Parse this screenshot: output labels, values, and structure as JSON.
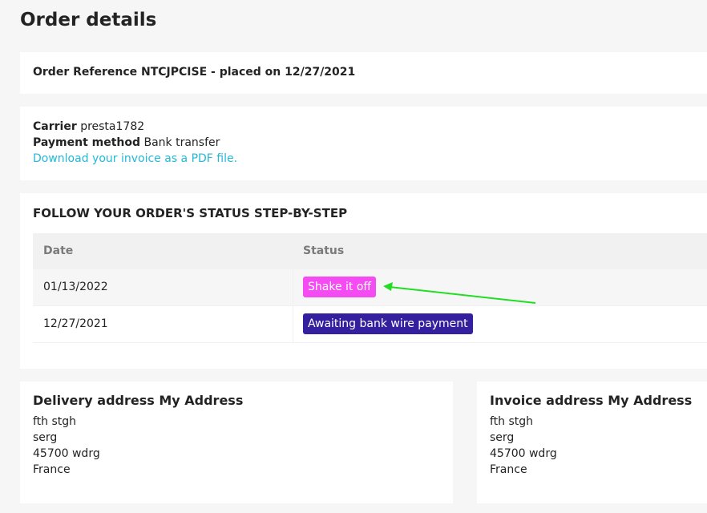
{
  "page": {
    "title": "Order details"
  },
  "reference": {
    "text": "Order Reference NTCJPCISE - placed on 12/27/2021"
  },
  "info": {
    "carrier_label": "Carrier",
    "carrier_value": "presta1782",
    "payment_label": "Payment method",
    "payment_value": "Bank transfer",
    "invoice_link": "Download your invoice as a PDF file."
  },
  "status_section": {
    "heading": "FOLLOW YOUR ORDER'S STATUS STEP-BY-STEP",
    "columns": [
      "Date",
      "Status"
    ],
    "rows": [
      {
        "date": "01/13/2022",
        "status": "Shake it off",
        "color": "#f54bf2"
      },
      {
        "date": "12/27/2021",
        "status": "Awaiting bank wire payment",
        "color": "#34209e"
      }
    ]
  },
  "annotation": {
    "arrow_color": "#22dd22"
  },
  "delivery_address": {
    "title": "Delivery address My Address",
    "lines": [
      "fth stgh",
      "serg",
      "45700 wdrg",
      "France"
    ]
  },
  "invoice_address": {
    "title": "Invoice address My Address",
    "lines": [
      "fth stgh",
      "serg",
      "45700 wdrg",
      "France"
    ]
  }
}
